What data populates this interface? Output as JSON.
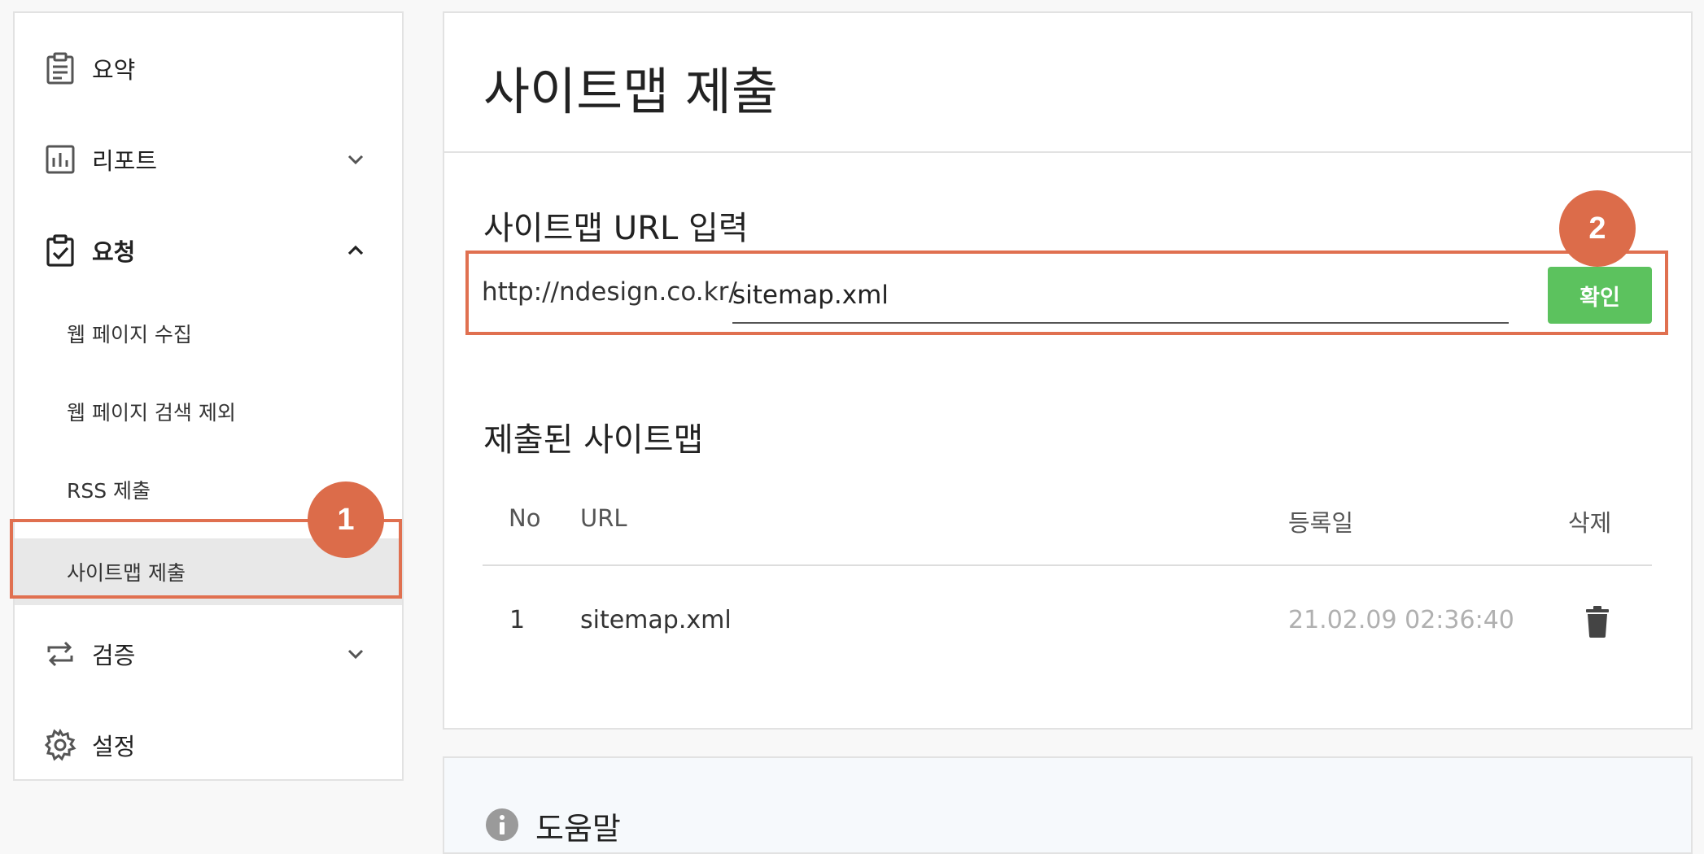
{
  "sidebar": {
    "items": [
      {
        "label": "요약",
        "icon": "clipboard-list-icon"
      },
      {
        "label": "리포트",
        "icon": "bar-chart-icon"
      },
      {
        "label": "요청",
        "icon": "clipboard-check-icon"
      },
      {
        "label": "검증",
        "icon": "repeat-icon"
      },
      {
        "label": "설정",
        "icon": "gear-icon"
      }
    ],
    "subitems": [
      {
        "label": "웹 페이지 수집"
      },
      {
        "label": "웹 페이지 검색 제외"
      },
      {
        "label": "RSS 제출"
      },
      {
        "label": "사이트맵 제출",
        "active": true
      }
    ]
  },
  "badges": {
    "one": "1",
    "two": "2"
  },
  "main": {
    "title": "사이트맵 제출",
    "url_section_label": "사이트맵 URL 입력",
    "url_prefix": "http://ndesign.co.kr/",
    "url_value": "sitemap.xml",
    "confirm_label": "확인",
    "submitted_label": "제출된 사이트맵",
    "table": {
      "headers": {
        "no": "No",
        "url": "URL",
        "date": "등록일",
        "delete": "삭제"
      },
      "rows": [
        {
          "no": "1",
          "url": "sitemap.xml",
          "date": "21.02.09 02:36:40"
        }
      ]
    }
  },
  "help": {
    "label": "도움말"
  },
  "colors": {
    "highlight": "#e07050",
    "badge": "#dc6c4a",
    "confirm": "#5cc25e"
  }
}
